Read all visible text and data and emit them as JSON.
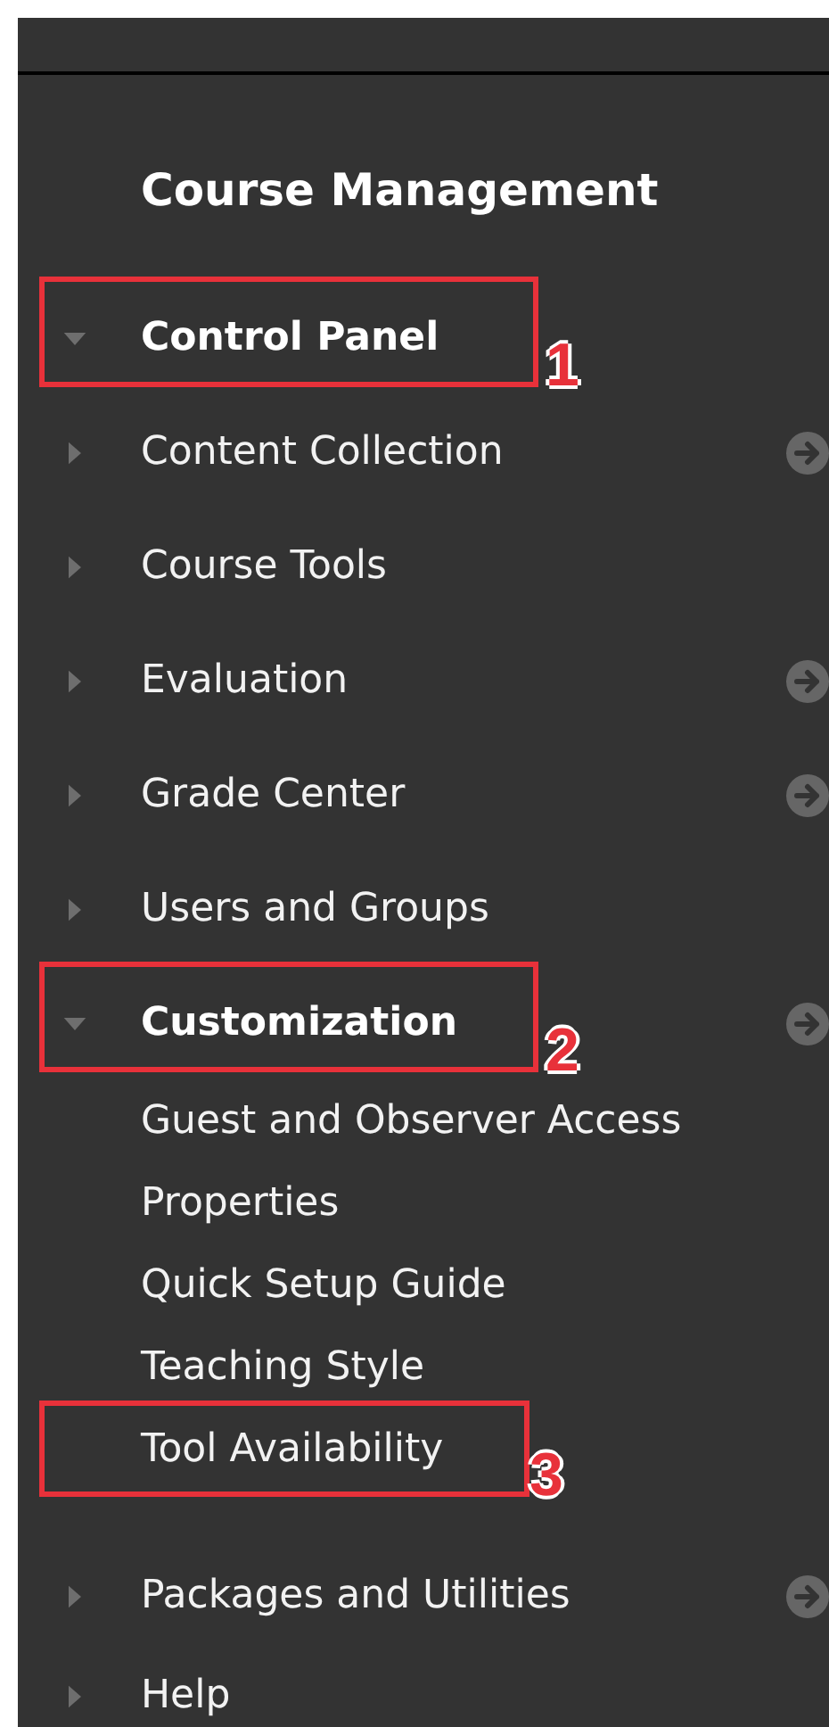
{
  "heading": "Course Management",
  "sections": [
    {
      "label": "Control Panel",
      "expanded": true,
      "arrow": false,
      "callout": "1"
    },
    {
      "label": "Content Collection",
      "expanded": false,
      "arrow": true
    },
    {
      "label": "Course Tools",
      "expanded": false,
      "arrow": false
    },
    {
      "label": "Evaluation",
      "expanded": false,
      "arrow": true
    },
    {
      "label": "Grade Center",
      "expanded": false,
      "arrow": true
    },
    {
      "label": "Users and Groups",
      "expanded": false,
      "arrow": false
    },
    {
      "label": "Customization",
      "expanded": true,
      "arrow": true,
      "callout": "2",
      "children": [
        {
          "label": "Guest and Observer Access"
        },
        {
          "label": "Properties"
        },
        {
          "label": "Quick Setup Guide"
        },
        {
          "label": "Teaching Style"
        },
        {
          "label": "Tool Availability",
          "callout": "3"
        }
      ]
    },
    {
      "label": "Packages and Utilities",
      "expanded": false,
      "arrow": true
    },
    {
      "label": "Help",
      "expanded": false,
      "arrow": false
    }
  ]
}
